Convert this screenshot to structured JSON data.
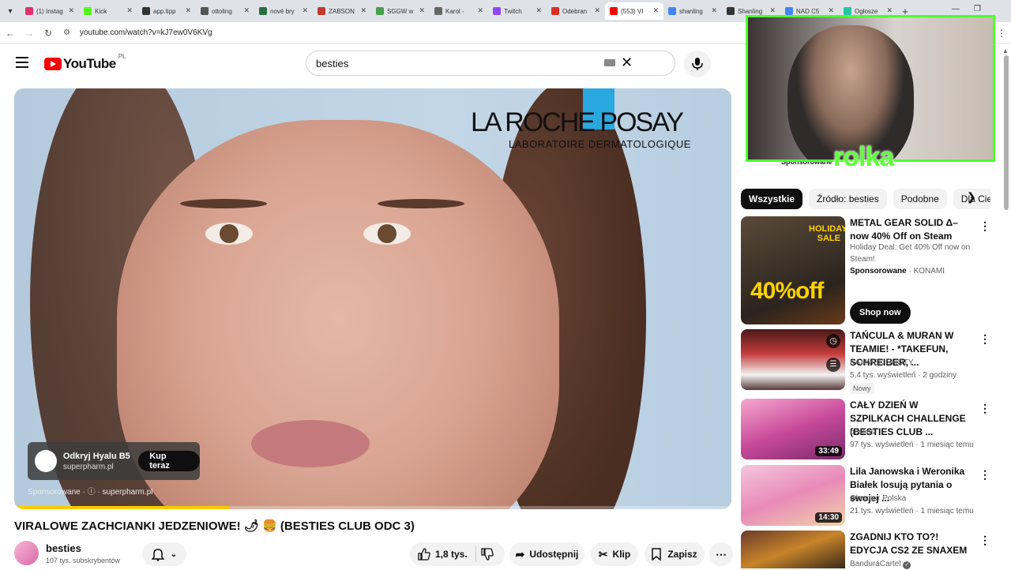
{
  "browser": {
    "tabs": [
      {
        "label": "(1) Instag",
        "color": "#e1306c"
      },
      {
        "label": "Kick",
        "color": "#53fc18"
      },
      {
        "label": "app.tipp",
        "color": "#333333"
      },
      {
        "label": "ottoling",
        "color": "#555555"
      },
      {
        "label": "nové bry",
        "color": "#2b6e3f"
      },
      {
        "label": "ZABSON",
        "color": "#c0392b"
      },
      {
        "label": "SGGW w",
        "color": "#4a9e4a"
      },
      {
        "label": "Karol -",
        "color": "#666666"
      },
      {
        "label": "Twitch",
        "color": "#9146ff"
      },
      {
        "label": "Odebran",
        "color": "#d93025"
      },
      {
        "label": "(553) VI",
        "color": "#ff0000"
      },
      {
        "label": "shanling",
        "color": "#4285f4"
      },
      {
        "label": "Shanling",
        "color": "#333333"
      },
      {
        "label": "NAD C5",
        "color": "#4285f4"
      },
      {
        "label": "Ogłosze",
        "color": "#23c4a7"
      }
    ],
    "url": "youtube.com/watch?v=kJ7ew0V6KVg"
  },
  "header": {
    "logo_text": "YouTube",
    "country_code": "PL",
    "search_value": "besties"
  },
  "video_ad": {
    "brand_name": "LA ROCHE POSAY",
    "brand_sub": "LABORATOIRE DERMATOLOGIQUE",
    "card_title": "Odkryj Hyalu B5",
    "card_domain": "superpharm.pl",
    "cta": "Kup teraz",
    "sponsored_label": "Sponsorowane · ⓘ · superpharm.pl",
    "progress": 0.3
  },
  "video_info": {
    "title": "VIRALOWE ZACHCIANKI JEDZENIOWE! 🌶 🍔 (BESTIES CLUB ODC 3)",
    "channel": "besties",
    "subscribers": "107 tys. subskrybentów",
    "likes": "1,8 tys.",
    "share_label": "Udostępnij",
    "clip_label": "Klip",
    "save_label": "Zapisz"
  },
  "webcam": {
    "label": "rolka",
    "hidden_label": "Sponsorowane"
  },
  "chips": [
    "Wszystkie",
    "Źródło: besties",
    "Podobne",
    "Dla Ciebie"
  ],
  "recommendations": [
    {
      "title": "METAL GEAR SOLID Δ– now 40% Off on Steam",
      "desc": "Holiday Deal: Get 40% Off now on Steam!",
      "sponsor": "Sponsorowane",
      "advertiser": "KONAMI",
      "cta": "Shop now",
      "thumb_big": "40%off",
      "thumb_small": "HOLIDAY SALE"
    },
    {
      "title": "TAŃCULA & MURAN W TEAMIE! - *TAKEFUN, SCHREIBER, ...",
      "channel": "KAMMEK SHOTY",
      "meta": "5,4 tys. wyświetleń · 2 godziny temu",
      "badge": "Nowy"
    },
    {
      "title": "CAŁY DZIEŃ W SZPILKACH CHALLENGE (BESTIES CLUB ...",
      "channel": "besties",
      "meta": "97 tys. wyświetleń · 1 miesiąc temu",
      "duration": "33:49"
    },
    {
      "title": "Lila Janowska i Weronika Białek losują pytania o swojej ...",
      "channel": "Glamour Polska",
      "meta": "21 tys. wyświetleń · 1 miesiąc temu",
      "duration": "14:30"
    },
    {
      "title": "ZGADNIJ KTO TO?! EDYCJA CS2 ZE SNAXEM",
      "channel": "BanduraCartel"
    }
  ]
}
